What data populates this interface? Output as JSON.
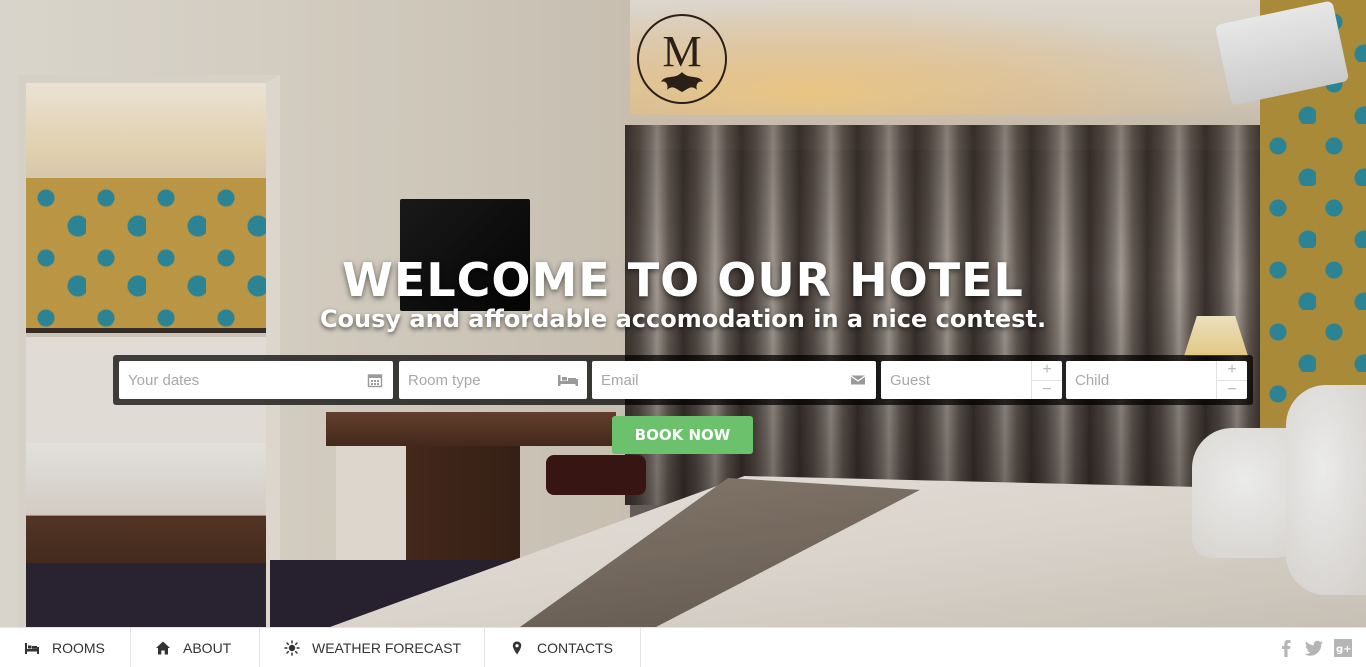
{
  "logo": {
    "letter": "M"
  },
  "hero": {
    "title": "WELCOME TO OUR HOTEL",
    "subtitle": "Cousy and affordable accomodation in a nice contest."
  },
  "booking": {
    "dates_placeholder": "Your dates",
    "dates_icon": "calendar-icon",
    "room_type_placeholder": "Room type",
    "room_type_icon": "bed-icon",
    "email_placeholder": "Email",
    "email_icon": "envelope-icon",
    "guest_placeholder": "Guest",
    "child_placeholder": "Child",
    "plus": "+",
    "minus": "−",
    "submit_label": "BOOK NOW",
    "submit_color": "#6cc26c"
  },
  "nav": {
    "items": [
      {
        "label": "ROOMS",
        "icon": "bed-icon"
      },
      {
        "label": "ABOUT",
        "icon": "home-icon"
      },
      {
        "label": "WEATHER FORECAST",
        "icon": "sun-icon"
      },
      {
        "label": "CONTACTS",
        "icon": "map-marker-icon"
      }
    ],
    "social": [
      "facebook-icon",
      "twitter-icon",
      "google-plus-icon"
    ]
  }
}
